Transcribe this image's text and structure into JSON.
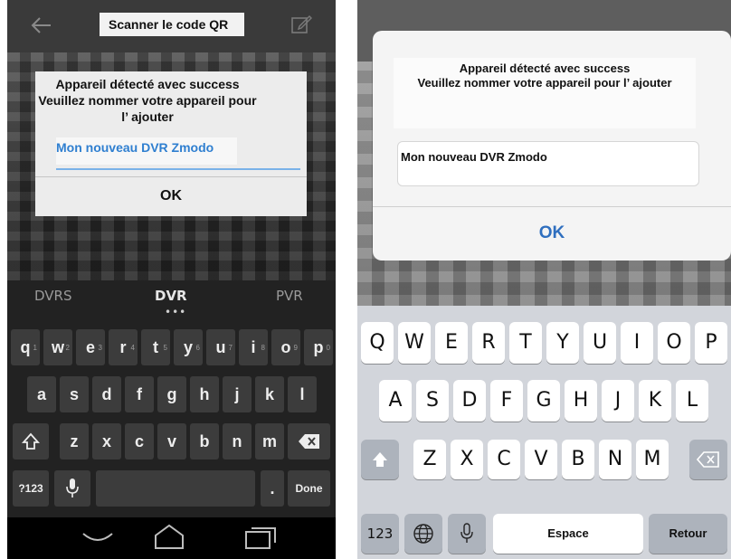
{
  "android": {
    "title": "Scanner le code QR",
    "dialog": {
      "line1": "Appareil détecté avec success",
      "line2": "Veuillez nommer votre appareil pour",
      "line3": "l’ ajouter",
      "input_value": "Mon nouveau DVR Zmodo",
      "ok_label": "OK"
    },
    "suggestions": [
      "DVRS",
      "DVR",
      "PVR"
    ],
    "keyboard": {
      "row1": [
        "q",
        "w",
        "e",
        "r",
        "t",
        "y",
        "u",
        "i",
        "o",
        "p"
      ],
      "row1_hints": [
        "1",
        "2",
        "3",
        "4",
        "5",
        "6",
        "7",
        "8",
        "9",
        "0"
      ],
      "row2": [
        "a",
        "s",
        "d",
        "f",
        "g",
        "h",
        "j",
        "k",
        "l"
      ],
      "row3": [
        "z",
        "x",
        "c",
        "v",
        "b",
        "n",
        "m"
      ],
      "symbols_label": "?123",
      "period_label": ".",
      "done_label": "Done"
    },
    "icons": [
      "back-arrow-icon",
      "edit-icon",
      "shift-icon",
      "backspace-icon",
      "mic-icon",
      "nav-back-icon",
      "nav-home-icon",
      "nav-recents-icon"
    ],
    "colors": {
      "accent": "#2f7fd0",
      "keyboard_bg": "#222222",
      "key_bg": "#3c3c3c"
    }
  },
  "ios": {
    "dialog": {
      "line1": "Appareil détecté avec success",
      "line2": "Veuillez nommer votre appareil pour l’ ajouter",
      "input_value": "Mon nouveau DVR Zmodo",
      "ok_label": "OK"
    },
    "keyboard": {
      "row1": [
        "Q",
        "W",
        "E",
        "R",
        "T",
        "Y",
        "U",
        "I",
        "O",
        "P"
      ],
      "row2": [
        "A",
        "S",
        "D",
        "F",
        "G",
        "H",
        "J",
        "K",
        "L"
      ],
      "row3": [
        "Z",
        "X",
        "C",
        "V",
        "B",
        "N",
        "M"
      ],
      "numbers_label": "123",
      "space_label": "Espace",
      "return_label": "Retour"
    },
    "icons": [
      "shift-icon",
      "backspace-icon",
      "globe-icon",
      "mic-icon"
    ],
    "colors": {
      "accent": "#2f6fbf",
      "keyboard_bg": "#d2d5db"
    }
  }
}
